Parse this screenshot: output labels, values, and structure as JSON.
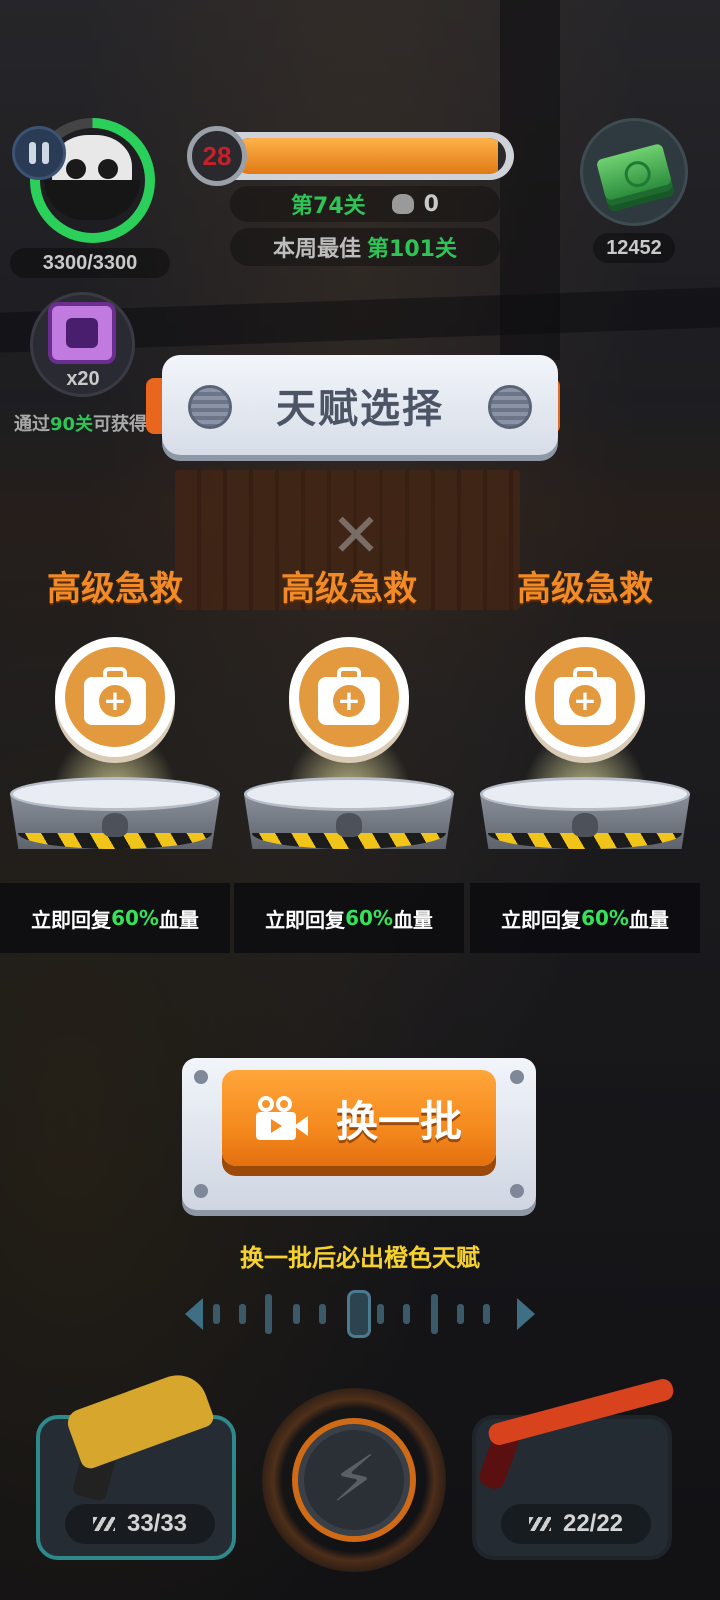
{
  "hud": {
    "hp": "3300/3300",
    "player_level": "28",
    "level_progress": 0.97,
    "stage": "第74关",
    "kills": "0",
    "best_label": "本周最佳",
    "best_stage": "第101关",
    "cash": "12452",
    "chip_count": "x20",
    "unlock_prefix": "通过",
    "unlock_level": "90关",
    "unlock_suffix": "可获得"
  },
  "dialog": {
    "title": "天赋选择",
    "close_icon": "close-x-icon",
    "cards": [
      {
        "name": "高级急救",
        "icon": "first-aid-kit-icon",
        "desc_prefix": "立即回复",
        "desc_value": "60%",
        "desc_suffix": "血量"
      },
      {
        "name": "高级急救",
        "icon": "first-aid-kit-icon",
        "desc_prefix": "立即回复",
        "desc_value": "60%",
        "desc_suffix": "血量"
      },
      {
        "name": "高级急救",
        "icon": "first-aid-kit-icon",
        "desc_prefix": "立即回复",
        "desc_value": "60%",
        "desc_suffix": "血量"
      }
    ],
    "refresh_label": "换一批",
    "refresh_icon": "video-camera-icon",
    "refresh_hint": "换一批后必出橙色天赋"
  },
  "weapons": {
    "left_ammo": "33/33",
    "right_ammo": "22/22",
    "skill_icon": "lightning-icon"
  },
  "colors": {
    "accent_orange": "#f58a1e",
    "title_orange": "#f28a26",
    "highlight_green": "#2fc458",
    "hint_yellow": "#f7d22e",
    "level_red": "#c8202a"
  }
}
